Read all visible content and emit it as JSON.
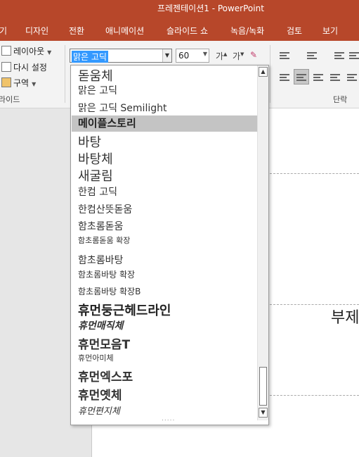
{
  "window": {
    "title": "프레젠테이션1  -  PowerPoint",
    "accent": "#b7472a"
  },
  "tabs": [
    "기",
    "디자인",
    "전환",
    "애니메이션",
    "슬라이드 쇼",
    "녹음/녹화",
    "검토",
    "보기"
  ],
  "ribbon": {
    "slides_group": {
      "layout": "레이아웃",
      "reset": "다시 설정",
      "section": "구역",
      "label": "라이드"
    },
    "font": {
      "name": "맑은 고딕",
      "size": "60",
      "grow_icon": "increase-font-size-icon",
      "shrink_icon": "decrease-font-size-icon",
      "clear_icon": "clear-formatting-icon"
    },
    "paragraph_label": "단락"
  },
  "font_list": {
    "selected": "메이플스토리",
    "items": [
      "돋움체",
      "맑은 고딕",
      "맑은 고딕 Semilight",
      "메이플스토리",
      "바탕",
      "바탕체",
      "새굴림",
      "한컴 고딕",
      "한컴산뜻돋움",
      "함초롬돋움",
      "함초롬돋움 확장",
      "함초롬바탕",
      "함초롬바탕 확장",
      "함초롬바탕 확장B",
      "휴먼둥근헤드라인",
      "휴먼매직체",
      "휴먼모음T",
      "휴먼아미체",
      "휴먼엑스포",
      "휴먼옛체",
      "휴먼편지체"
    ],
    "grip": "....."
  },
  "slide": {
    "subtitle_fragment": "부제"
  }
}
